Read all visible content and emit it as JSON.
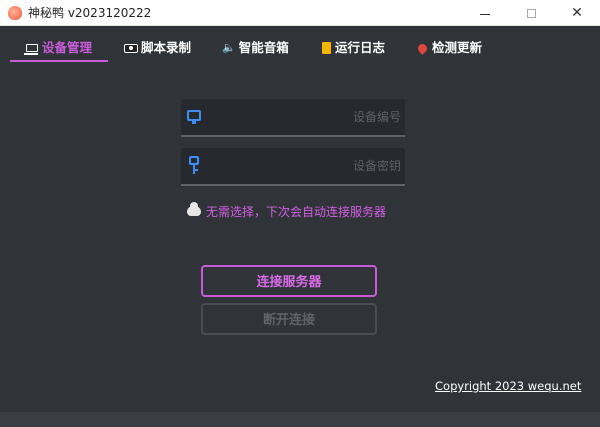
{
  "window": {
    "title": "神秘鸭 v2023120222",
    "close_glyph": "✕"
  },
  "tabs": [
    {
      "label": "设备管理",
      "icon": "laptop-icon",
      "active": true
    },
    {
      "label": "脚本录制",
      "icon": "camera-icon",
      "active": false
    },
    {
      "label": "智能音箱",
      "icon": "speaker-icon",
      "active": false
    },
    {
      "label": "运行日志",
      "icon": "note-icon",
      "active": false
    },
    {
      "label": "检测更新",
      "icon": "pin-icon",
      "active": false
    }
  ],
  "form": {
    "device_id_placeholder": "设备编号",
    "device_key_placeholder": "设备密钥",
    "auto_connect_text": "无需选择，下次会自动连接服务器"
  },
  "buttons": {
    "connect": "连接服务器",
    "disconnect": "断开连接"
  },
  "footer": {
    "copyright": "Copyright 2023 wequ.net"
  },
  "colors": {
    "accent": "#c85bd9",
    "background": "#303338",
    "field_icon": "#3e8ef7"
  },
  "icons": {
    "speaker": "🔈"
  }
}
